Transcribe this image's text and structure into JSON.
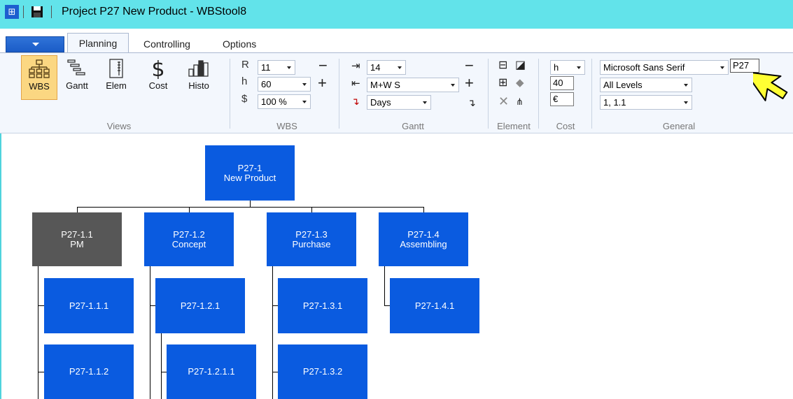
{
  "window": {
    "title": "Project P27 New Product - WBStool8"
  },
  "tabs": [
    "Planning",
    "Controlling",
    "Options"
  ],
  "ribbon": {
    "views": {
      "label": "Views",
      "buttons": [
        "WBS",
        "Gantt",
        "Elem",
        "Cost",
        "Histo"
      ]
    },
    "wbs": {
      "label": "WBS",
      "r_label": "R",
      "r_value": "11",
      "h_label": "h",
      "h_value": "60",
      "dollar_label": "$",
      "zoom_value": "100 %"
    },
    "gantt": {
      "label": "Gantt",
      "value1": "14",
      "value2": "M+W S",
      "value3": "Days"
    },
    "element": {
      "label": "Element"
    },
    "cost": {
      "label": "Cost",
      "unit": "h",
      "hours": "40",
      "currency": "€"
    },
    "general": {
      "label": "General",
      "font": "Microsoft Sans Serif",
      "project_code": "P27",
      "levels": "All Levels",
      "numbering": "1, 1.1"
    }
  },
  "wbs_tree": {
    "root": {
      "code": "P27-1",
      "name": "New Product"
    },
    "level1": [
      {
        "code": "P27-1.1",
        "name": "PM"
      },
      {
        "code": "P27-1.2",
        "name": "Concept"
      },
      {
        "code": "P27-1.3",
        "name": "Purchase"
      },
      {
        "code": "P27-1.4",
        "name": "Assembling"
      }
    ],
    "level2": [
      "P27-1.1.1",
      "P27-1.2.1",
      "P27-1.3.1",
      "P27-1.4.1",
      "P27-1.1.2",
      "P27-1.2.1.1",
      "P27-1.3.2"
    ]
  },
  "colors": {
    "titlebar": "#62e3ea",
    "node": "#0a5be0",
    "node_pm": "#575757",
    "active_button": "#fbd782",
    "cursor": "#ffff33"
  }
}
